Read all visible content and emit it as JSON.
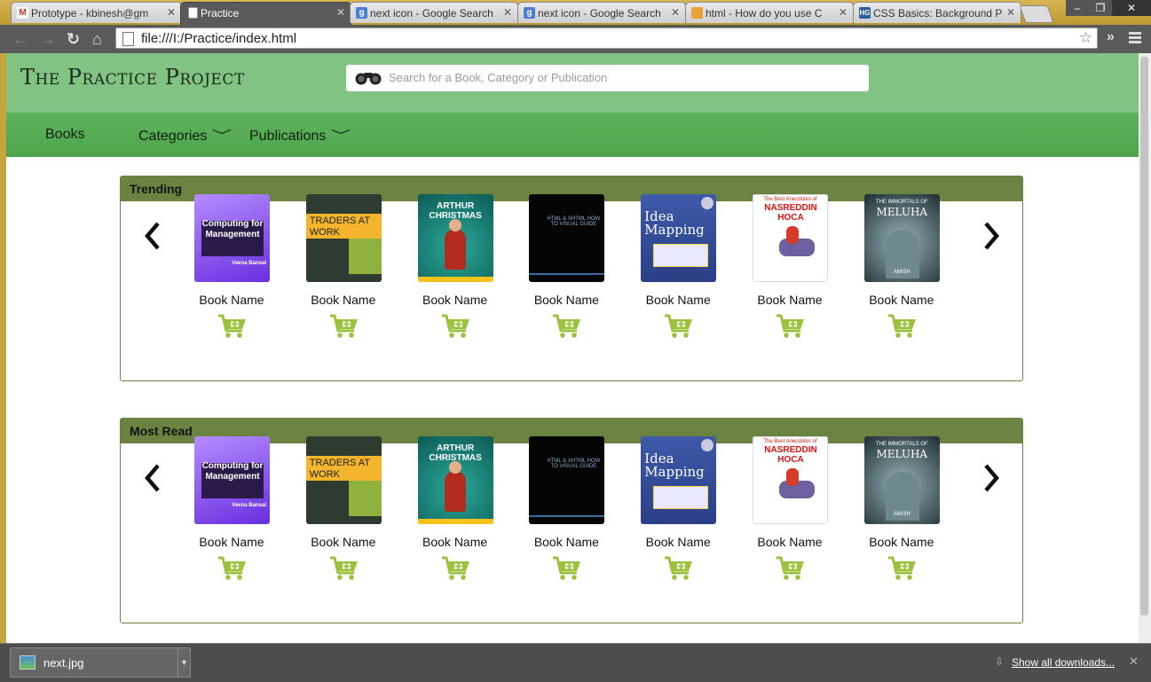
{
  "browser": {
    "tabs": [
      {
        "title": "Prototype - kbinesh@gm",
        "favicon": "gmail-icon",
        "active": false
      },
      {
        "title": "Practice",
        "favicon": "page-icon",
        "active": true
      },
      {
        "title": "next icon - Google Search",
        "favicon": "google-icon",
        "active": false
      },
      {
        "title": "next icon - Google Search",
        "favicon": "google-icon",
        "active": false
      },
      {
        "title": "html - How do you use C",
        "favicon": "stackoverflow-icon",
        "active": false
      },
      {
        "title": "CSS Basics: Background P",
        "favicon": "hg-icon",
        "active": false
      }
    ],
    "url": "file:///I:/Practice/index.html"
  },
  "site": {
    "title": "The Practice Project",
    "search_placeholder": "Search for a Book, Category or Publication",
    "nav": [
      {
        "label": "Books",
        "has_dropdown": false
      },
      {
        "label": "Categories",
        "has_dropdown": true
      },
      {
        "label": "Publications",
        "has_dropdown": true
      }
    ]
  },
  "sections": [
    {
      "title": "Trending",
      "books": [
        {
          "name": "Book Name",
          "cover_text": "Computing for Management",
          "author": "Veena Bansal"
        },
        {
          "name": "Book Name",
          "cover_text": "TRADERS AT WORK"
        },
        {
          "name": "Book Name",
          "cover_text": "ARTHUR CHRISTMAS"
        },
        {
          "name": "Book Name",
          "cover_text": "HTML & XHTML HOW TO VISUAL GUIDE"
        },
        {
          "name": "Book Name",
          "cover_text": "Idea Mapping"
        },
        {
          "name": "Book Name",
          "cover_text": "NASREDDIN HOCA",
          "subtitle": "The Best Anecdotes of"
        },
        {
          "name": "Book Name",
          "cover_text": "MELUHA",
          "subtitle": "THE IMMORTALS OF",
          "author": "AMISH"
        }
      ]
    },
    {
      "title": "Most Read",
      "books": [
        {
          "name": "Book Name",
          "cover_text": "Computing for Management",
          "author": "Veena Bansal"
        },
        {
          "name": "Book Name",
          "cover_text": "TRADERS AT WORK"
        },
        {
          "name": "Book Name",
          "cover_text": "ARTHUR CHRISTMAS"
        },
        {
          "name": "Book Name",
          "cover_text": "HTML & XHTML HOW TO VISUAL GUIDE"
        },
        {
          "name": "Book Name",
          "cover_text": "Idea Mapping"
        },
        {
          "name": "Book Name",
          "cover_text": "NASREDDIN HOCA",
          "subtitle": "The Best Anecdotes of"
        },
        {
          "name": "Book Name",
          "cover_text": "MELUHA",
          "subtitle": "THE IMMORTALS OF",
          "author": "AMISH"
        }
      ]
    }
  ],
  "downloads": {
    "file": "next.jpg",
    "show_all": "Show all downloads..."
  },
  "colors": {
    "header": "#80c383",
    "navbar": "#55ab53",
    "panel_border": "#6b8340",
    "cart": "#9bc23c"
  }
}
